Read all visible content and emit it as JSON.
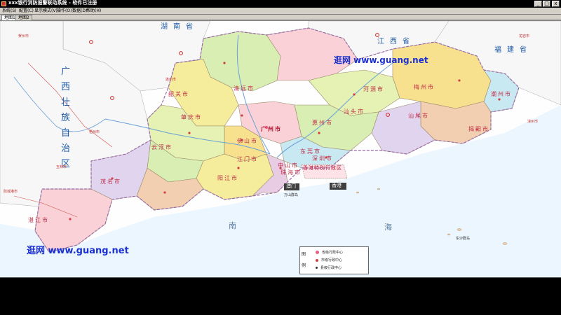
{
  "window": {
    "title": "xxx银行消防报警联动系统  -  软件已注册",
    "minimize": "_",
    "maximize": "□",
    "close": "x"
  },
  "menu": {
    "items": [
      "系统(S)",
      "配置(C)",
      "显示模式(V)",
      "操作(O)",
      "数据(D)",
      "帮助(H)"
    ]
  },
  "tabs": {
    "items": [
      "地图1",
      "地图2"
    ]
  },
  "map": {
    "provinces": {
      "hunan": "湖南省",
      "jiangxi": "江西省",
      "fujian": "福建省",
      "guangxi": "广西壮族自治区"
    },
    "cities": {
      "shaoguan": "韶关市",
      "qingyuan": "清远市",
      "heyuan": "河源市",
      "meizhou": "梅州市",
      "chaozhou": "潮州市",
      "shantou": "汕头市",
      "jieyang": "揭阳市",
      "shanwei": "汕尾市",
      "huizhou": "惠州市",
      "guangzhou": "广州市",
      "foshan": "佛山市",
      "zhaoqing": "肇庆市",
      "yunfu": "云浮市",
      "jiangmen": "江门市",
      "yangjiang": "阳江市",
      "maoming": "茂名市",
      "zhanjiang": "湛江市",
      "zhongshan": "中山市",
      "zhuhai": "珠海市",
      "shenzhen": "深圳市",
      "dongguan": "东莞市",
      "macau": "澳门",
      "hongkong": "香港",
      "hk_sar": "香港特别行政区",
      "hezhou": "贺州市",
      "wuzhou": "梧州市",
      "yulin": "玉林市",
      "fangchenggang": "防城港市",
      "lianzhou": "连州市",
      "longyan": "龙岩市",
      "zhangzhou": "漳州市"
    },
    "sea": {
      "nan": "南",
      "hai": "海",
      "wanshan": "万山群岛",
      "dongsha": "东沙群岛"
    },
    "watermark_top": "逛网 www.guang.net",
    "watermark_bottom": "逛网 www.guang.net"
  },
  "legend": {
    "title": "图例",
    "items": [
      "省级行政中心",
      "市级行政中心",
      "县级行政中心"
    ],
    "colors": [
      "#e86080",
      "#d04040",
      "#303030"
    ]
  },
  "colors": {
    "map_bg": "#fefefe",
    "sea": "#cfe7f5",
    "river": "#6aa0d8",
    "provinces": [
      "#f6ed9c",
      "#e5f2b3",
      "#fad1d6",
      "#d8eeb2",
      "#f2cfb0",
      "#e0d4ee",
      "#c8e9f2",
      "#f7e08e",
      "#e7cce4"
    ]
  }
}
